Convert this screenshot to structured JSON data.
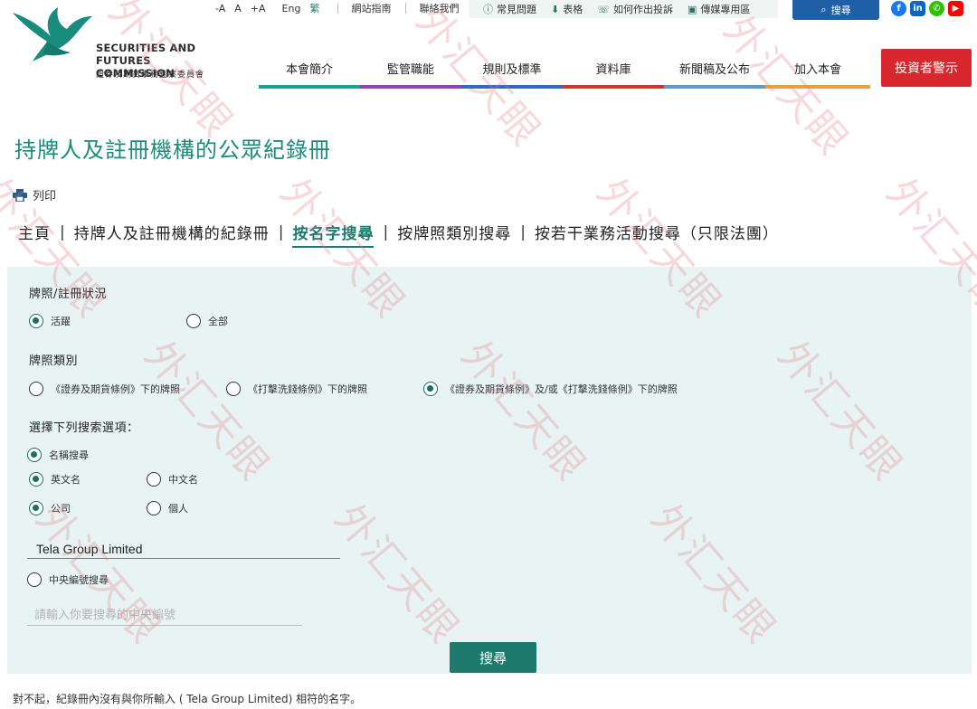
{
  "header": {
    "logo_en_line1": "SECURITIES AND",
    "logo_en_line2": "FUTURES COMMISSION",
    "logo_zh": "證券及期貨事務監察委員會",
    "font_sizes": [
      "-A",
      "A",
      "+A"
    ],
    "lang_eng": "Eng",
    "lang_trad": "繁",
    "site_guide": "網站指南",
    "contact_us": "聯絡我們",
    "quick_links": [
      "常見問題",
      "表格",
      "如何作出投訴",
      "傳媒專用區"
    ],
    "search_label": "搜尋",
    "social": [
      "f",
      "in",
      "✆",
      "▶"
    ]
  },
  "nav": {
    "items": [
      "本會簡介",
      "監管職能",
      "規則及標準",
      "資料庫",
      "新聞稿及公布",
      "加入本會"
    ],
    "colors": [
      "#19a391",
      "#9a3fb0",
      "#2d6ac4",
      "#d0342c",
      "#5b9bd5",
      "#e9a23b"
    ],
    "alert_button": "投資者警示"
  },
  "page": {
    "title": "持牌人及註冊機構的公眾紀錄冊",
    "print": "列印",
    "tabs": [
      "主頁",
      "持牌人及註冊機構的紀錄冊",
      "按名字搜尋",
      "按牌照類別搜尋",
      "按若干業務活動搜尋（只限法團）"
    ],
    "active_tab": "按名字搜尋"
  },
  "form": {
    "status_label": "牌照/註冊狀況",
    "status_active": "活躍",
    "status_all": "全部",
    "licence_label": "牌照類別",
    "licence_sfo": "《證券及期貨條例》下的牌照",
    "licence_amlo": "《打擊洗錢條例》下的牌照",
    "licence_both": "《證券及期貨條例》及/或《打擊洗錢條例》下的牌照",
    "option_label": "選擇下列搜索選項：",
    "name_search": "名稱搜尋",
    "english_name": "英文名",
    "chinese_name": "中文名",
    "company": "公司",
    "individual": "個人",
    "name_value": "Tela Group Limited",
    "ce_search": "中央編號搜尋",
    "ce_placeholder": "請輸入你要搜尋的中央編號",
    "submit": "搜尋"
  },
  "result": "對不起，紀錄冊內沒有與你所輸入 ( Tela Group Limited) 相符的名字。",
  "watermark": "外汇天眼",
  "colors": {
    "brand_teal": "#1c8a7d",
    "alert_red": "#d9272e",
    "search_blue": "#1f5fa8",
    "panel": "#e8f4f3"
  }
}
